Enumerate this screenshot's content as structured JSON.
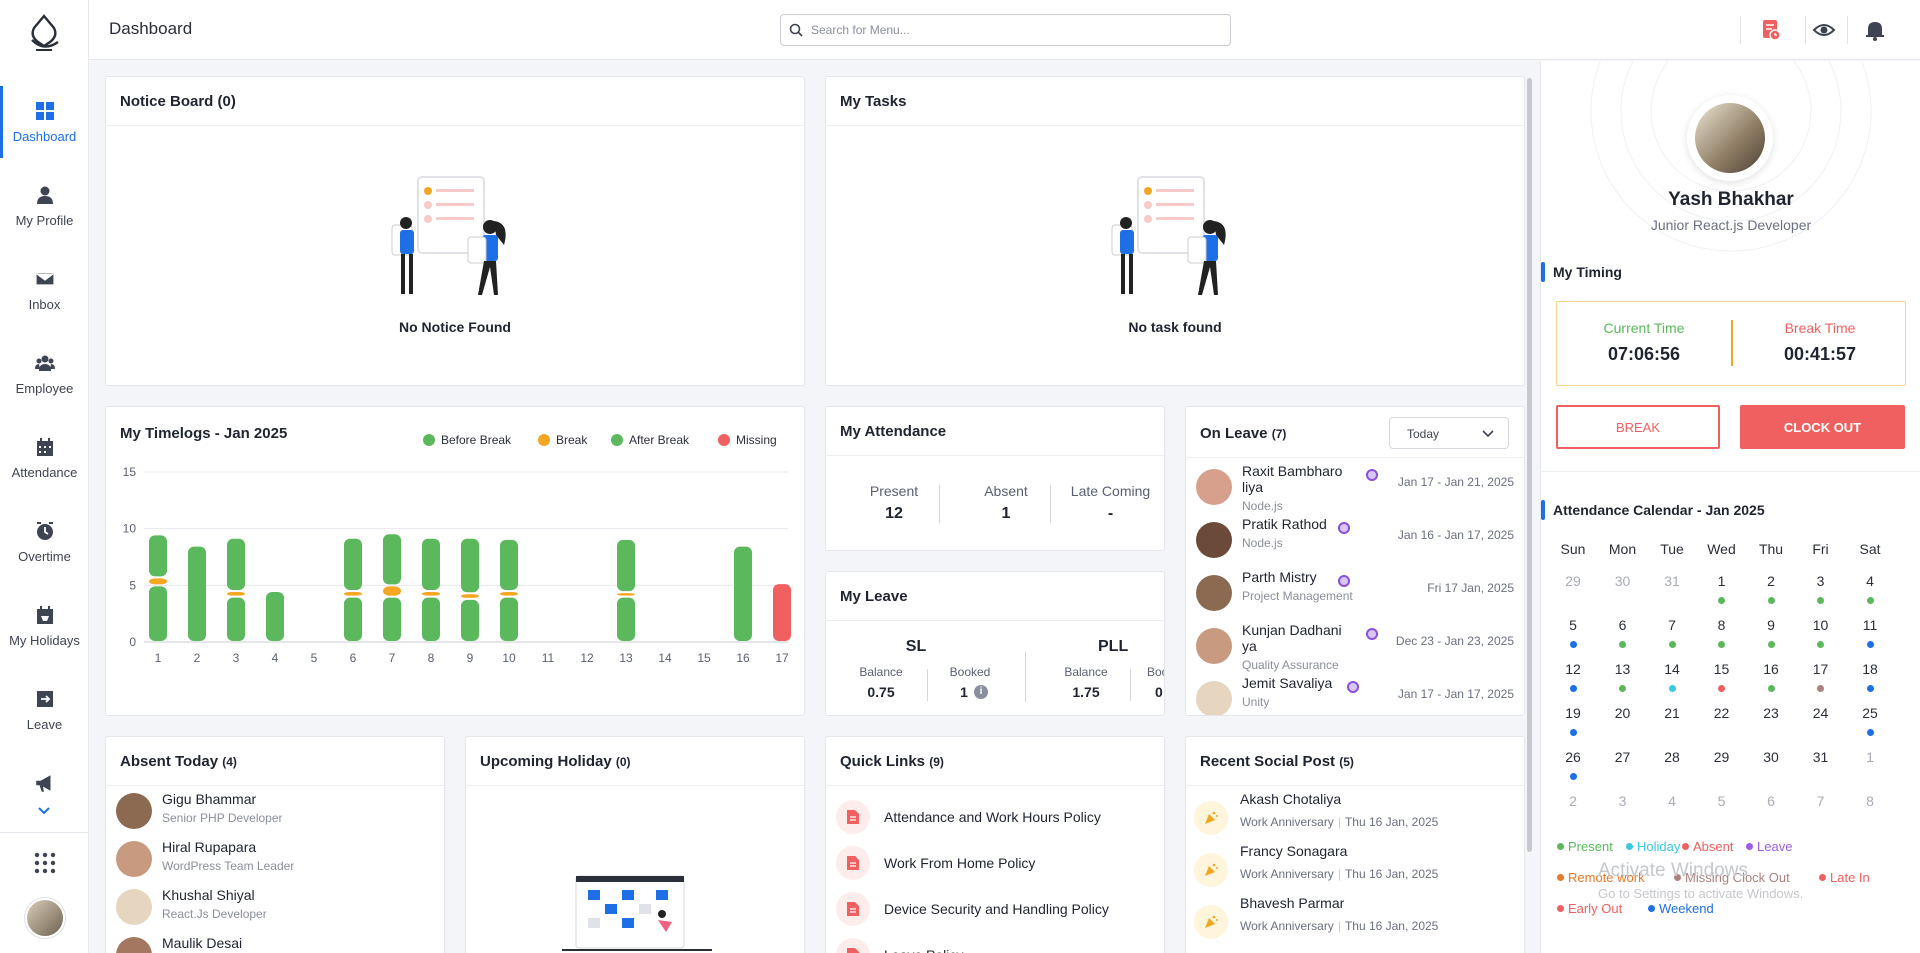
{
  "header": {
    "title": "Dashboard",
    "search_placeholder": "Search for Menu..."
  },
  "sidebar": {
    "items": [
      {
        "label": "Dashboard",
        "icon": "grid-icon"
      },
      {
        "label": "My Profile",
        "icon": "user-icon"
      },
      {
        "label": "Inbox",
        "icon": "mail-icon"
      },
      {
        "label": "Employee",
        "icon": "users-icon"
      },
      {
        "label": "Attendance",
        "icon": "calendar-icon"
      },
      {
        "label": "Overtime",
        "icon": "clock-icon"
      },
      {
        "label": "My Holidays",
        "icon": "holiday-icon"
      },
      {
        "label": "Leave",
        "icon": "leave-icon"
      }
    ]
  },
  "notice_board": {
    "title": "Notice Board (0)",
    "empty": "No Notice Found"
  },
  "my_tasks": {
    "title": "My Tasks",
    "empty": "No task found"
  },
  "timelogs": {
    "title": "My Timelogs - Jan 2025",
    "legend": [
      {
        "label": "Before Break",
        "color": "#5cb85c"
      },
      {
        "label": "Break",
        "color": "#f5a623"
      },
      {
        "label": "After Break",
        "color": "#5cb85c"
      },
      {
        "label": "Missing",
        "color": "#f06060"
      }
    ],
    "chart_data": {
      "type": "bar",
      "title": "My Timelogs - Jan 2025",
      "x": [
        1,
        2,
        3,
        4,
        5,
        6,
        7,
        8,
        9,
        10,
        11,
        12,
        13,
        14,
        15,
        16,
        17
      ],
      "yticks": [
        0,
        5,
        10,
        15
      ],
      "ylim": [
        0,
        15
      ],
      "series": [
        {
          "name": "Before Break",
          "values": [
            5.0,
            8.5,
            4.0,
            4.5,
            0,
            4.0,
            4.0,
            4.0,
            3.8,
            4.0,
            0,
            0,
            4.0,
            0,
            0,
            8.5,
            0
          ]
        },
        {
          "name": "Break",
          "values": [
            0.7,
            0,
            0.5,
            0,
            0,
            0.5,
            1.0,
            0.5,
            0.5,
            0.5,
            0,
            0,
            0.4,
            0,
            0,
            0,
            0
          ]
        },
        {
          "name": "After Break",
          "values": [
            3.8,
            0,
            4.7,
            0,
            0,
            4.7,
            4.6,
            4.7,
            4.9,
            4.6,
            0,
            0,
            4.7,
            0,
            0,
            0,
            0
          ]
        },
        {
          "name": "Missing",
          "values": [
            0,
            0,
            0,
            0,
            0,
            0,
            0,
            0,
            0,
            0,
            0,
            0,
            0,
            0,
            0,
            0,
            5.2
          ]
        }
      ]
    }
  },
  "attendance": {
    "title": "My Attendance",
    "items": [
      {
        "label": "Present",
        "value": "12"
      },
      {
        "label": "Absent",
        "value": "1"
      },
      {
        "label": "Late Coming",
        "value": "-"
      }
    ]
  },
  "leave": {
    "title": "My Leave",
    "types": [
      {
        "code": "SL",
        "balance_label": "Balance",
        "balance": "0.75",
        "booked_label": "Booked",
        "booked": "1"
      },
      {
        "code": "PLL",
        "balance_label": "Balance",
        "balance": "1.75",
        "booked_label": "Booked",
        "booked": "0"
      }
    ]
  },
  "on_leave": {
    "title": "On Leave",
    "count": "(7)",
    "filter": "Today",
    "people": [
      {
        "name": "Raxit Bambharo liya",
        "sub": "Node.js",
        "date": "Jan 17 - Jan 21, 2025",
        "badge": "#8a4fe0"
      },
      {
        "name": "Pratik Rathod",
        "sub": "Node.js",
        "date": "Jan 16 - Jan 17, 2025",
        "badge": "#8a4fe0"
      },
      {
        "name": "Parth Mistry",
        "sub": "Project Management",
        "date": "Fri 17 Jan, 2025",
        "badge": "#8a4fe0"
      },
      {
        "name": "Kunjan Dadhani ya",
        "sub": "Quality Assurance",
        "date": "Dec 23 - Jan 23, 2025",
        "badge": "#8a4fe0"
      },
      {
        "name": "Jemit Savaliya",
        "sub": "Unity",
        "date": "Jan 17 - Jan 17, 2025",
        "badge": "#8a4fe0"
      }
    ]
  },
  "absent_today": {
    "title": "Absent Today",
    "count": "(4)",
    "people": [
      {
        "name": "Gigu Bhammar",
        "sub": "Senior PHP Developer"
      },
      {
        "name": "Hiral Rupapara",
        "sub": "WordPress Team Leader"
      },
      {
        "name": "Khushal Shiyal",
        "sub": "React.Js Developer"
      },
      {
        "name": "Maulik Desai",
        "sub": ""
      }
    ]
  },
  "upcoming_holiday": {
    "title": "Upcoming Holiday",
    "count": "(0)"
  },
  "quick_links": {
    "title": "Quick Links",
    "count": "(9)",
    "items": [
      "Attendance and Work Hours Policy",
      "Work From Home Policy",
      "Device Security and Handling Policy",
      "Leave Policy"
    ]
  },
  "social": {
    "title": "Recent Social Post",
    "count": "(5)",
    "posts": [
      {
        "name": "Akash Chotaliya",
        "type": "Work Anniversary",
        "date": "Thu 16 Jan, 2025"
      },
      {
        "name": "Francy Sonagara",
        "type": "Work Anniversary",
        "date": "Thu 16 Jan, 2025"
      },
      {
        "name": "Bhavesh Parmar",
        "type": "Work Anniversary",
        "date": "Thu 16 Jan, 2025"
      }
    ]
  },
  "profile": {
    "name": "Yash Bhakhar",
    "role": "Junior React.js Developer"
  },
  "timing": {
    "title": "My Timing",
    "current_label": "Current Time",
    "current": "07:06:56",
    "break_label": "Break Time",
    "break": "00:41:57",
    "break_btn": "BREAK",
    "clockout_btn": "CLOCK OUT"
  },
  "calendar": {
    "title": "Attendance Calendar - Jan 2025",
    "weekdays": [
      "Sun",
      "Mon",
      "Tue",
      "Wed",
      "Thu",
      "Fri",
      "Sat"
    ],
    "weeks": [
      [
        [
          "29",
          "m",
          ""
        ],
        [
          "30",
          "m",
          ""
        ],
        [
          "31",
          "m",
          ""
        ],
        [
          "1",
          "",
          "p"
        ],
        [
          "2",
          "",
          "p"
        ],
        [
          "3",
          "",
          "p"
        ],
        [
          "4",
          "",
          "p"
        ]
      ],
      [
        [
          "5",
          "",
          "w"
        ],
        [
          "6",
          "",
          "p"
        ],
        [
          "7",
          "",
          "p"
        ],
        [
          "8",
          "",
          "p"
        ],
        [
          "9",
          "",
          "p"
        ],
        [
          "10",
          "",
          "p"
        ],
        [
          "11",
          "",
          "w"
        ]
      ],
      [
        [
          "12",
          "",
          "w"
        ],
        [
          "13",
          "",
          "p"
        ],
        [
          "14",
          "",
          "h"
        ],
        [
          "15",
          "",
          "a"
        ],
        [
          "16",
          "",
          "p"
        ],
        [
          "17",
          "",
          "mc"
        ],
        [
          "18",
          "",
          "w"
        ]
      ],
      [
        [
          "19",
          "",
          "w"
        ],
        [
          "20",
          "",
          ""
        ],
        [
          "21",
          "",
          ""
        ],
        [
          "22",
          "",
          ""
        ],
        [
          "23",
          "",
          ""
        ],
        [
          "24",
          "",
          ""
        ],
        [
          "25",
          "",
          "w"
        ]
      ],
      [
        [
          "26",
          "",
          "w"
        ],
        [
          "27",
          "",
          ""
        ],
        [
          "28",
          "",
          ""
        ],
        [
          "29",
          "",
          ""
        ],
        [
          "30",
          "",
          ""
        ],
        [
          "31",
          "",
          ""
        ],
        [
          "1",
          "m",
          ""
        ]
      ],
      [
        [
          "2",
          "m",
          ""
        ],
        [
          "3",
          "m",
          ""
        ],
        [
          "4",
          "m",
          ""
        ],
        [
          "5",
          "m",
          ""
        ],
        [
          "6",
          "m",
          ""
        ],
        [
          "7",
          "m",
          ""
        ],
        [
          "8",
          "m",
          ""
        ]
      ]
    ],
    "legend": [
      {
        "label": "Present",
        "color": "#5cb85c"
      },
      {
        "label": "Holiday",
        "color": "#3cc8e0"
      },
      {
        "label": "Absent",
        "color": "#f06060"
      },
      {
        "label": "Leave",
        "color": "#9b5de5"
      },
      {
        "label": "Remote work",
        "color": "#e8782a"
      },
      {
        "label": "Missing Clock Out",
        "color": "#b08080"
      },
      {
        "label": "Late In",
        "color": "#f06060"
      },
      {
        "label": "Early Out",
        "color": "#f06060"
      },
      {
        "label": "Weekend",
        "color": "#1e6fe6"
      }
    ],
    "colors": {
      "p": "#5cb85c",
      "w": "#1e6fe6",
      "h": "#3cc8e0",
      "a": "#f06060",
      "mc": "#b08080"
    }
  },
  "watermark": {
    "line1": "Activate Windows",
    "line2": "Go to Settings to activate Windows."
  }
}
